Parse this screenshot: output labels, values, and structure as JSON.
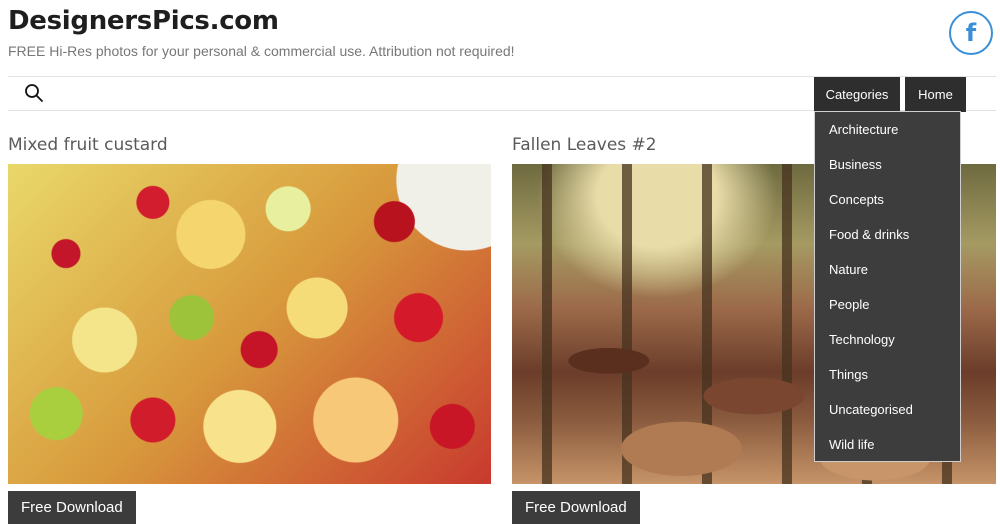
{
  "site": {
    "title": "DesignersPics.com",
    "tagline": "FREE Hi-Res photos for your personal & commercial use. Attribution not required!",
    "social_icon": "facebook-icon",
    "social_letter": "f"
  },
  "nav": {
    "search_icon": "search-icon",
    "categories_label": "Categories",
    "home_label": "Home",
    "dropdown_items": [
      "Architecture",
      "Business",
      "Concepts",
      "Food & drinks",
      "Nature",
      "People",
      "Technology",
      "Things",
      "Uncategorised",
      "Wild life"
    ]
  },
  "posts": [
    {
      "title": "Mixed fruit custard",
      "download_label": "Free Download"
    },
    {
      "title": "Fallen Leaves #2",
      "download_label": "Free Download"
    }
  ],
  "colors": {
    "nav_bg": "#2e2e2e",
    "dropdown_bg": "#3d3d3d",
    "button_bg": "#3c3c3c",
    "facebook_blue": "#3b8fd6"
  }
}
